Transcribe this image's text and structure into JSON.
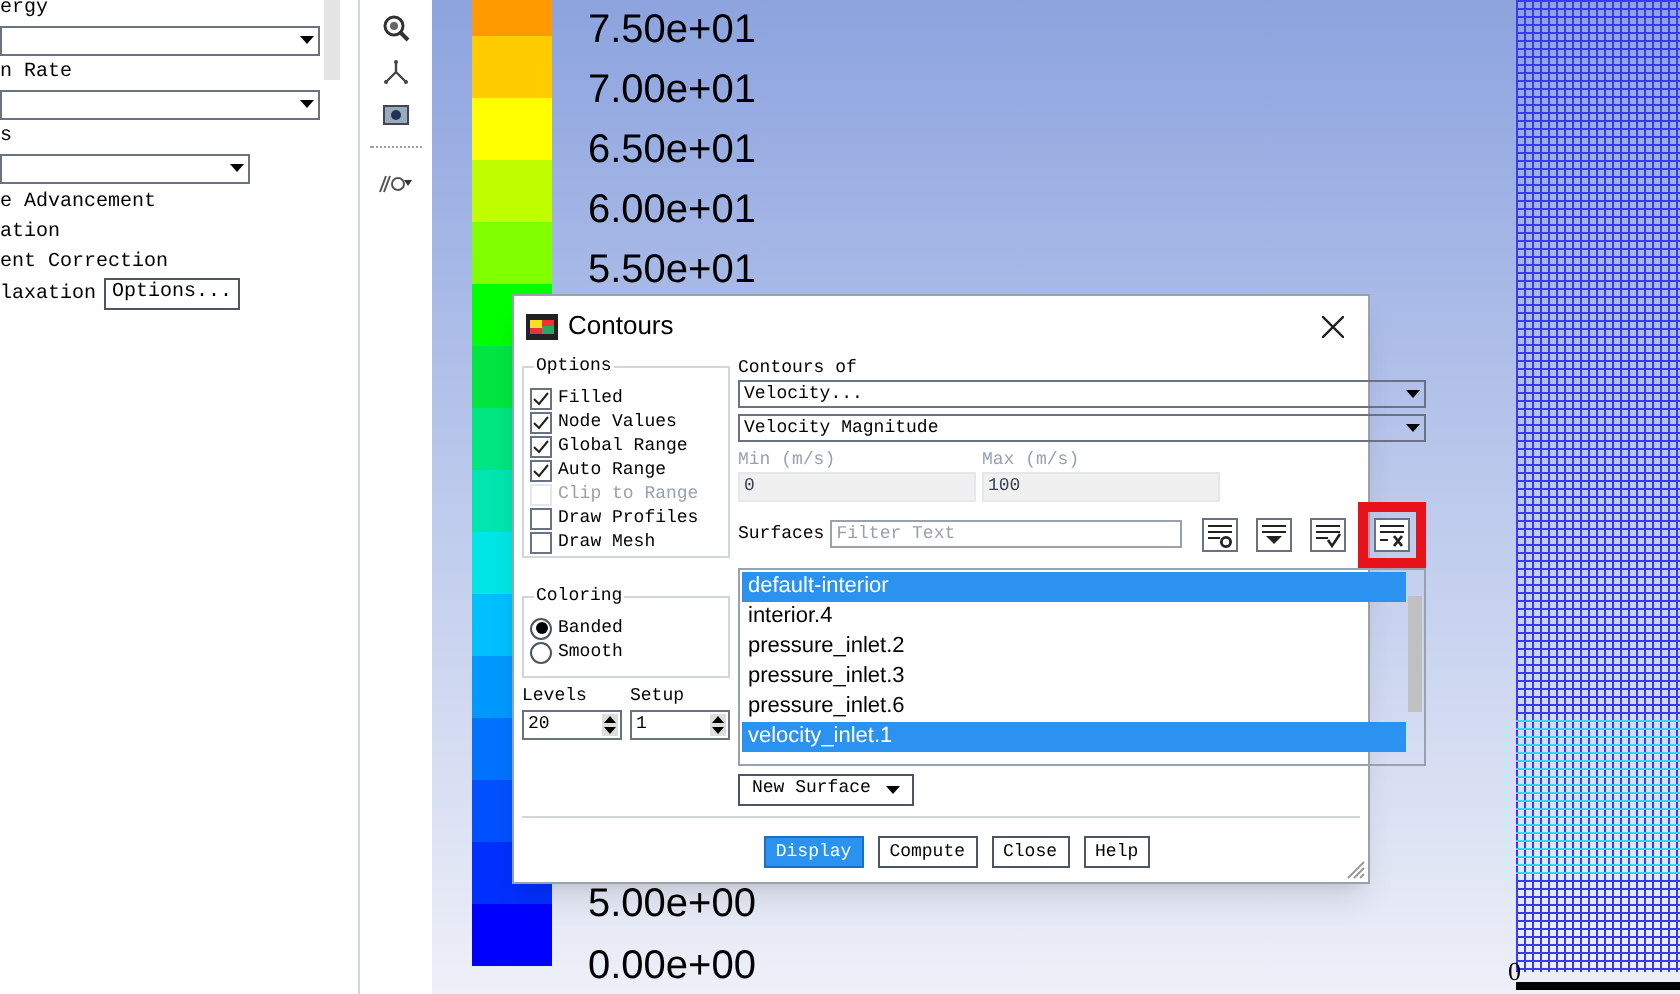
{
  "left_panel": {
    "items": [
      {
        "kind": "label",
        "text": "ergy"
      },
      {
        "kind": "dropdown"
      },
      {
        "kind": "label",
        "text": "n Rate"
      },
      {
        "kind": "dropdown"
      },
      {
        "kind": "label",
        "text": "s"
      },
      {
        "kind": "short_dropdown"
      },
      {
        "kind": "label",
        "text": "e Advancement"
      },
      {
        "kind": "label",
        "text": "ation"
      },
      {
        "kind": "label",
        "text": "ent Correction"
      }
    ],
    "last_row": {
      "text": "laxation",
      "button": "Options..."
    }
  },
  "legend": {
    "labels_top": [
      "7.50e+01",
      "7.00e+01",
      "6.50e+01",
      "6.00e+01",
      "5.50e+01"
    ],
    "labels_bottom": [
      "5.00e+00",
      "0.00e+00"
    ]
  },
  "mesh": {
    "axis_label": "0"
  },
  "dialog": {
    "title": "Contours",
    "options": {
      "title": "Options",
      "items": [
        {
          "label": "Filled",
          "checked": true,
          "disabled": false
        },
        {
          "label": "Node Values",
          "checked": true,
          "disabled": false
        },
        {
          "label": "Global Range",
          "checked": true,
          "disabled": false
        },
        {
          "label": "Auto Range",
          "checked": true,
          "disabled": false
        },
        {
          "label": "Clip to Range",
          "checked": false,
          "disabled": true
        },
        {
          "label": "Draw Profiles",
          "checked": false,
          "disabled": false
        },
        {
          "label": "Draw Mesh",
          "checked": false,
          "disabled": false
        }
      ]
    },
    "coloring": {
      "title": "Coloring",
      "items": [
        {
          "label": "Banded",
          "selected": true
        },
        {
          "label": "Smooth",
          "selected": false
        }
      ]
    },
    "levels": {
      "label": "Levels",
      "value": "20"
    },
    "setup": {
      "label": "Setup",
      "value": "1"
    },
    "contours_of": {
      "label": "Contours of",
      "dropdowns": [
        "Velocity...",
        "Velocity Magnitude"
      ]
    },
    "min": {
      "label": "Min (m/s)",
      "value": "0",
      "disabled": true
    },
    "max": {
      "label": "Max (m/s)",
      "value": "100",
      "disabled": true
    },
    "surfaces": {
      "label": "Surfaces",
      "placeholder": "Filter Text",
      "tools": [
        {
          "kind": "create",
          "highlighted": false
        },
        {
          "kind": "select",
          "highlighted": false
        },
        {
          "kind": "select_all",
          "highlighted": false
        },
        {
          "kind": "deselect_all",
          "highlighted": true
        }
      ],
      "items": [
        {
          "label": "default-interior",
          "selected": true
        },
        {
          "label": "interior.4",
          "selected": false
        },
        {
          "label": "pressure_inlet.2",
          "selected": false
        },
        {
          "label": "pressure_inlet.3",
          "selected": false
        },
        {
          "label": "pressure_inlet.6",
          "selected": false
        },
        {
          "label": "velocity_inlet.1",
          "selected": true
        }
      ]
    },
    "new_surface": "New Surface",
    "buttons": [
      {
        "label": "Display",
        "default": true
      },
      {
        "label": "Compute",
        "default": false
      },
      {
        "label": "Close",
        "default": false
      },
      {
        "label": "Help",
        "default": false
      }
    ]
  }
}
